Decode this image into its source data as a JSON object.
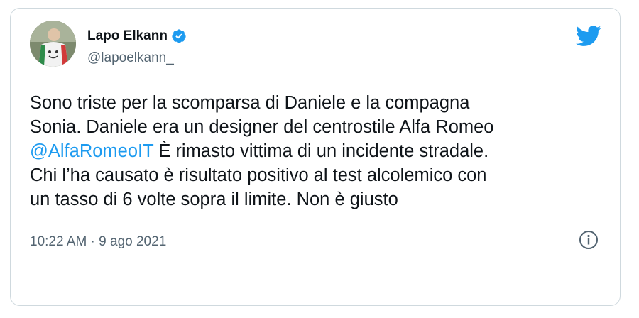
{
  "author": {
    "name": "Lapo Elkann",
    "handle": "@lapoelkann_"
  },
  "tweet": {
    "line1": "Sono triste per la scomparsa di Daniele e la compagna",
    "line2": "Sonia. Daniele era un designer del centrostile Alfa Romeo",
    "mention": "@AlfaRomeoIT",
    "line3_rest": " È rimasto vittima di un incidente stradale.",
    "line4": "Chi l’ha causato è risultato positivo al test alcolemico con",
    "line5": "un tasso di 6 volte sopra il limite. Non è giusto"
  },
  "meta": {
    "timestamp": "10:22 AM · 9 ago 2021"
  },
  "icons": {
    "verified": "verified-badge-icon",
    "brand": "twitter-bird-icon",
    "info": "info-icon"
  },
  "colors": {
    "accent": "#1d9bf0",
    "text": "#0f1419",
    "muted": "#536471",
    "border": "#cfd9de"
  }
}
